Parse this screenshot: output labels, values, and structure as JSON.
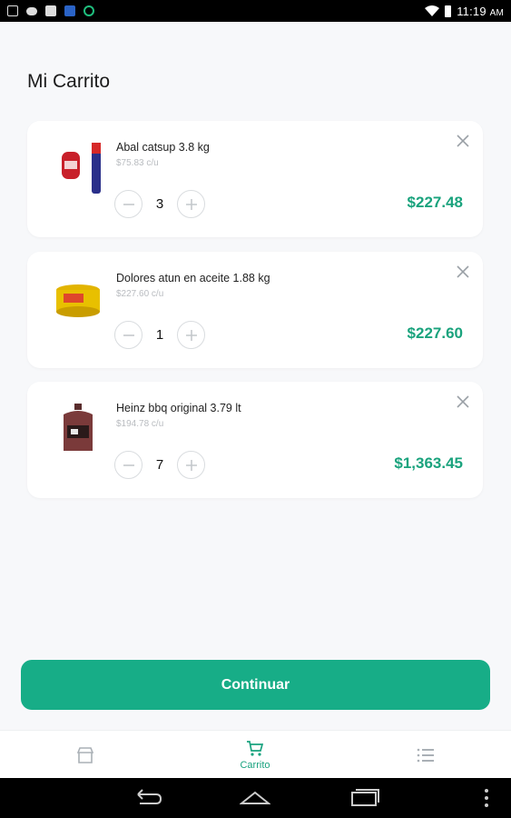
{
  "status_bar": {
    "time": "11:19",
    "ampm": "AM"
  },
  "page_title": "Mi Carrito",
  "cart": {
    "items": [
      {
        "name": "Abal catsup 3.8 kg",
        "unit_price": "$75.83 c/u",
        "quantity": "3",
        "total": "$227.48"
      },
      {
        "name": "Dolores atun en aceite 1.88 kg",
        "unit_price": "$227.60 c/u",
        "quantity": "1",
        "total": "$227.60"
      },
      {
        "name": "Heinz bbq original 3.79 lt",
        "unit_price": "$194.78 c/u",
        "quantity": "7",
        "total": "$1,363.45"
      }
    ]
  },
  "continue_label": "Continuar",
  "bottom_nav": {
    "store": {
      "icon": "store-icon"
    },
    "cart": {
      "label": "Carrito",
      "icon": "cart-icon"
    },
    "list": {
      "icon": "list-icon"
    }
  },
  "colors": {
    "accent": "#17ad87",
    "price": "#1aa37d",
    "muted": "#b9bcc0"
  }
}
